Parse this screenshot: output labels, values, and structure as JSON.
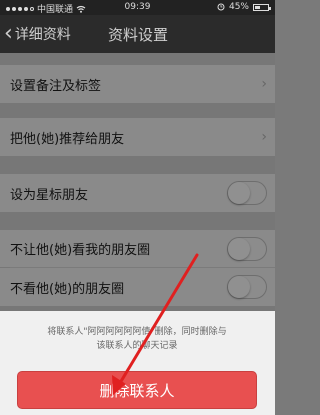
{
  "status_bar": {
    "carrier": "中国联通",
    "time": "09:39",
    "battery_text": "45%",
    "battery_level": 0.45,
    "signal_bars_filled": 4,
    "signal_bars_total": 5,
    "icons": [
      "signal-icon",
      "wifi-icon",
      "alarm-icon",
      "battery-icon"
    ]
  },
  "nav": {
    "back_label": "详细资料",
    "title": "资料设置"
  },
  "rows": [
    {
      "label": "设置备注及标签",
      "type": "arrow"
    },
    {
      "label": "把他(她)推荐给朋友",
      "type": "arrow"
    },
    {
      "label": "设为星标朋友",
      "type": "toggle",
      "on": false
    },
    {
      "label": "不让他(她)看我的朋友圈",
      "type": "toggle",
      "on": false
    },
    {
      "label": "不看他(她)的朋友圈",
      "type": "toggle",
      "on": false
    }
  ],
  "sheet": {
    "message_line1": "将联系人\"阿阿阿阿阿阿倩\"删除，同时删除与",
    "message_line2": "该联系人的聊天记录",
    "delete_label": "删除联系人"
  },
  "colors": {
    "delete_button": "#e85050",
    "annotation_arrow": "#e02020",
    "nav_background": "#2b2b2b"
  }
}
